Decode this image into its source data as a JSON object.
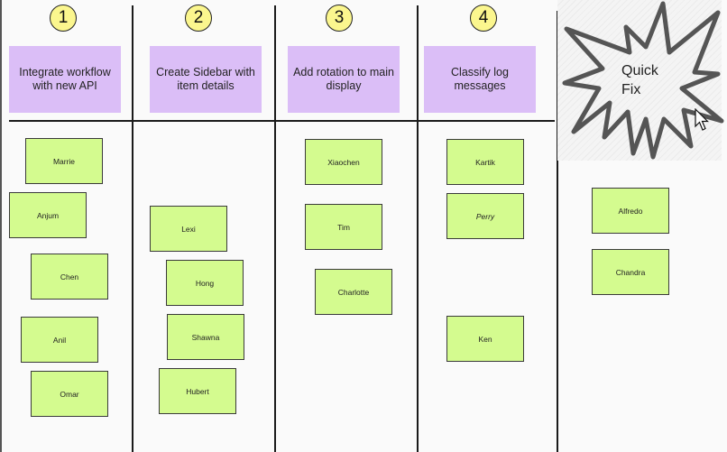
{
  "board": {
    "columns": [
      {
        "number": "1",
        "task": "Integrate workflow with new API",
        "assignees": [
          "Marrie",
          "Anjum",
          "Chen",
          "Anil",
          "Omar"
        ]
      },
      {
        "number": "2",
        "task": "Create Sidebar with item details",
        "assignees": [
          "Lexi",
          "Hong",
          "Shawna",
          "Hubert"
        ]
      },
      {
        "number": "3",
        "task": "Add rotation to main display",
        "assignees": [
          "Xiaochen",
          "Tim",
          "Charlotte"
        ]
      },
      {
        "number": "4",
        "task": "Classify log messages",
        "assignees": [
          "Kartik",
          "Perry",
          "Ken"
        ]
      },
      {
        "label": "Quick Fix",
        "label_lines": [
          "Quick",
          "Fix"
        ],
        "assignees": [
          "Alfredo",
          "Chandra"
        ]
      }
    ]
  },
  "colors": {
    "task_card": "#dbbef7",
    "sticky_note": "#d4fb8f",
    "number_circle": "#fbf68e",
    "starburst_stroke": "#555555",
    "background": "#fafafa"
  },
  "icons": {
    "starburst": "starburst-shape",
    "cursor": "mouse-pointer-icon"
  }
}
